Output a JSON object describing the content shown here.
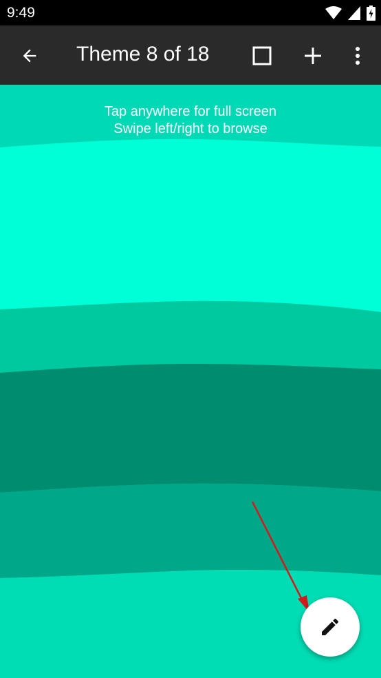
{
  "status_bar": {
    "time": "9:49",
    "icons": [
      "wifi-icon",
      "signal-icon",
      "battery-icon"
    ]
  },
  "app_bar": {
    "title": "Theme 8 of 18",
    "actions": [
      "back-arrow-icon",
      "square-outline-icon",
      "plus-icon",
      "more-vert-icon"
    ]
  },
  "hint": {
    "line1": "Tap anywhere for full screen",
    "line2": "Swipe left/right to browse"
  },
  "colors": {
    "band1": "#00D9B5",
    "band2": "#00FFD6",
    "band3": "#00C99F",
    "band4": "#008C6E",
    "band5": "#00A889",
    "band6": "#00DDB4",
    "annotation_arrow": "#D01C1C"
  },
  "fab": {
    "icon": "pencil-icon"
  }
}
